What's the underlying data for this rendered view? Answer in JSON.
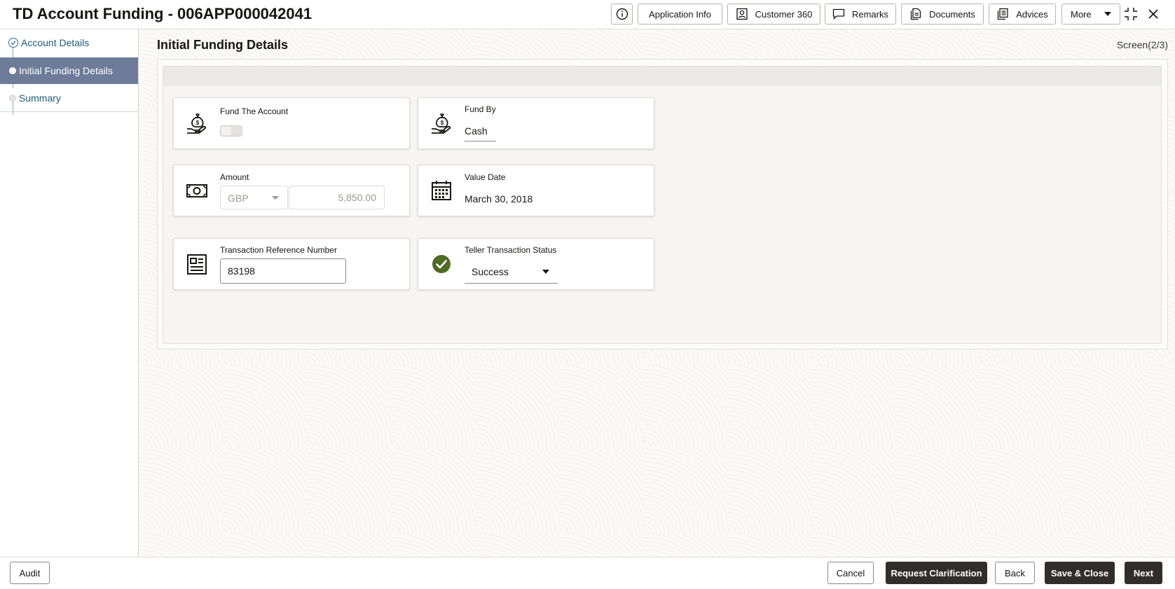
{
  "header": {
    "title": "TD Account Funding - 006APP000042041",
    "buttons": {
      "info_icon": "info-icon",
      "application_info": "Application Info",
      "customer_360": "Customer 360",
      "remarks": "Remarks",
      "documents": "Documents",
      "advices": "Advices",
      "more": "More"
    }
  },
  "sidebar": {
    "steps": [
      {
        "label": "Account Details",
        "state": "completed"
      },
      {
        "label": "Initial Funding Details",
        "state": "current"
      },
      {
        "label": "Summary",
        "state": "pending"
      }
    ]
  },
  "main": {
    "title": "Initial Funding Details",
    "screen_indicator": "Screen(2/3)",
    "fields": {
      "fund_the_account": {
        "label": "Fund The Account",
        "value": false
      },
      "fund_by": {
        "label": "Fund By",
        "value": "Cash"
      },
      "amount": {
        "label": "Amount",
        "currency": "GBP",
        "value": "5,850.00"
      },
      "value_date": {
        "label": "Value Date",
        "value": "March 30, 2018"
      },
      "transaction_reference": {
        "label": "Transaction Reference Number",
        "value": "83198"
      },
      "teller_status": {
        "label": "Teller Transaction Status",
        "value": "Success"
      }
    }
  },
  "footer": {
    "audit": "Audit",
    "cancel": "Cancel",
    "request_clarification": "Request Clarification",
    "back": "Back",
    "save_close": "Save & Close",
    "next": "Next"
  },
  "colors": {
    "sidebar_active": "#6e7c9a",
    "link": "#1d5b79",
    "success": "#4f6b24",
    "primary_button": "#312d2a"
  }
}
